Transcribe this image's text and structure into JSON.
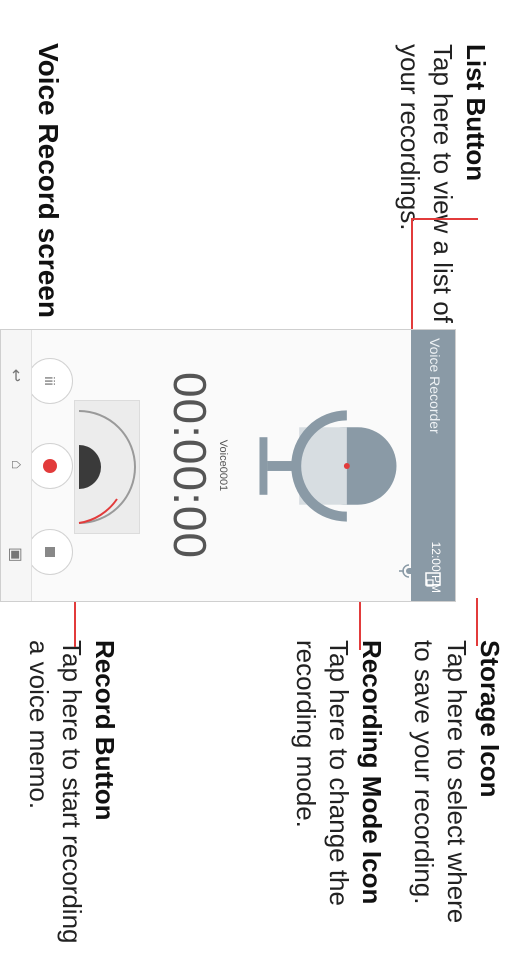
{
  "annotations": {
    "list_button": {
      "title": "List Button",
      "desc_lines": [
        "Tap here to view a list of",
        "your recordings."
      ]
    },
    "storage_icon": {
      "title": "Storage Icon",
      "desc_lines": [
        "Tap here to select where",
        "to save your recording."
      ]
    },
    "recording_mode_icon": {
      "title": "Recording Mode Icon",
      "desc_lines": [
        "Tap here to change the",
        "recording mode."
      ]
    },
    "record_button": {
      "title": "Record Button",
      "desc_lines": [
        "Tap here to start recording",
        "a voice memo."
      ]
    }
  },
  "caption": "Voice Record screen",
  "phone": {
    "app_title": "Voice Recorder",
    "status_time": "12:00 PM",
    "file_name": "Voice0001",
    "timer": "00:00:00",
    "list_button_glyph": "iii",
    "icons": [
      "storage-icon",
      "recording-mode-icon",
      "microphone-icon",
      "list-icon",
      "record-icon",
      "stop-icon",
      "back-icon",
      "home-icon",
      "recent-apps-icon"
    ]
  },
  "colors": {
    "accent": "#e23b3b",
    "status_bar": "#8a9aa6"
  }
}
